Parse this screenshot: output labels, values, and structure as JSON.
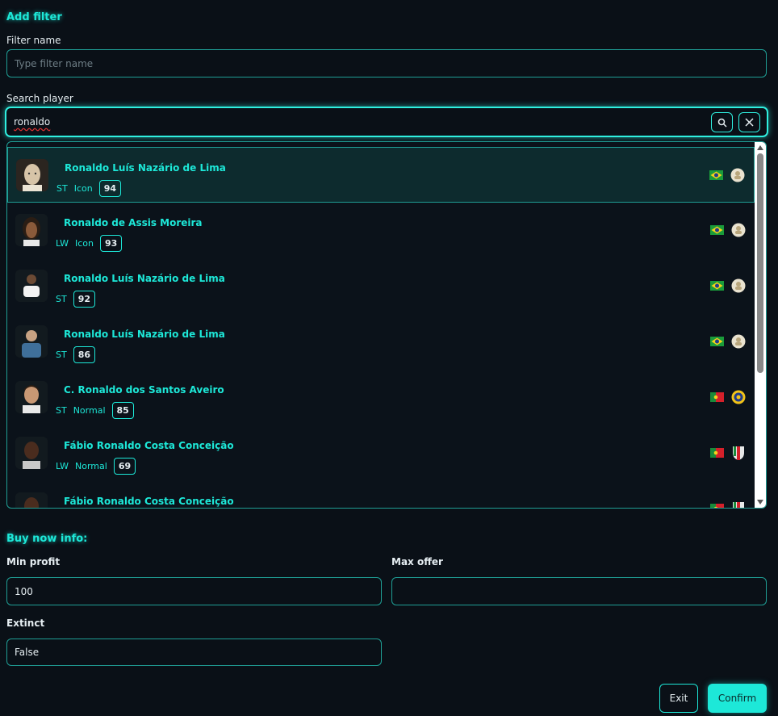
{
  "add_filter": {
    "title": "Add filter",
    "filter_name_label": "Filter name",
    "filter_name_placeholder": "Type filter name",
    "search_label": "Search player",
    "search_value": "ronaldo"
  },
  "results": [
    {
      "name": "Ronaldo Luís Nazário de Lima",
      "position": "ST",
      "type": "Icon",
      "rating": "94",
      "nation": "brazil-flag",
      "club": "icon-badge",
      "portrait": "bald"
    },
    {
      "name": "Ronaldo de Assis Moreira",
      "position": "LW",
      "type": "Icon",
      "rating": "93",
      "nation": "brazil-flag",
      "club": "icon-badge",
      "portrait": "long-hair"
    },
    {
      "name": "Ronaldo Luís Nazário de Lima",
      "position": "ST",
      "type": "",
      "rating": "92",
      "nation": "brazil-flag",
      "club": "icon-badge",
      "portrait": "white-kit"
    },
    {
      "name": "Ronaldo Luís Nazário de Lima",
      "position": "ST",
      "type": "",
      "rating": "86",
      "nation": "brazil-flag",
      "club": "icon-badge",
      "portrait": "blue-kit"
    },
    {
      "name": "C. Ronaldo dos Santos Aveiro",
      "position": "ST",
      "type": "Normal",
      "rating": "85",
      "nation": "portugal-flag",
      "club": "al-nassr-badge",
      "portrait": "short-hair"
    },
    {
      "name": "Fábio Ronaldo Costa Conceição",
      "position": "LW",
      "type": "Normal",
      "rating": "69",
      "nation": "portugal-flag",
      "club": "estrela-badge",
      "portrait": "dark"
    },
    {
      "name": "Fábio Ronaldo Costa Conceição",
      "position": "",
      "type": "",
      "rating": "",
      "nation": "portugal-flag",
      "club": "estrela-badge",
      "portrait": "dark"
    }
  ],
  "buy_now": {
    "title": "Buy now info:",
    "min_profit_label": "Min profit",
    "min_profit_value": "100",
    "max_offer_label": "Max offer",
    "max_offer_value": "",
    "extinct_label": "Extinct",
    "extinct_value": "False"
  },
  "buttons": {
    "exit": "Exit",
    "confirm": "Confirm"
  },
  "colors": {
    "accent": "#1de8d8",
    "background": "#0a1017",
    "border": "#1f9e95"
  }
}
